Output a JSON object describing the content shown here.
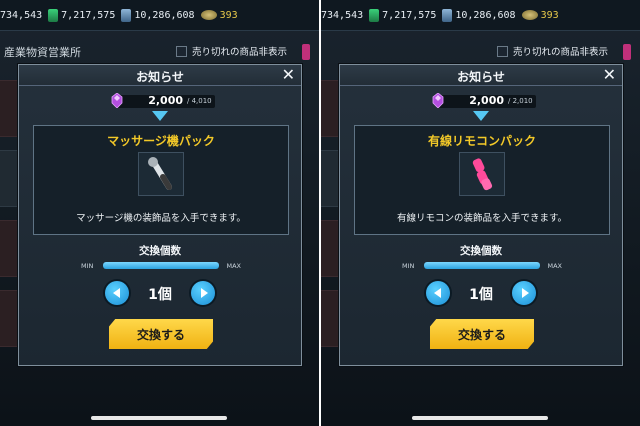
{
  "left": {
    "resources": [
      "734,543",
      "7,217,575",
      "10,286,608",
      "393"
    ],
    "shop_title": "産業物資営業所",
    "hide_soldout": "売り切れの商品非表示",
    "modal": {
      "title": "お知らせ",
      "close": "✕",
      "cost_value": "2,000",
      "cost_max": "/ 4,010",
      "item_name": "マッサージ機パック",
      "item_desc": "マッサージ機の装飾品を入手できます。",
      "qty_label": "交換個数",
      "slider_min": "MIN",
      "slider_max": "MAX",
      "slider_fraction": 1.0,
      "qty_value": "1個",
      "exchange": "交換する"
    }
  },
  "right": {
    "resources": [
      "734,543",
      "7,217,575",
      "10,286,608",
      "393"
    ],
    "shop_title": "",
    "hide_soldout": "売り切れの商品非表示",
    "modal": {
      "title": "お知らせ",
      "close": "✕",
      "cost_value": "2,000",
      "cost_max": "/ 2,010",
      "item_name": "有線リモコンパック",
      "item_desc": "有線リモコンの装飾品を入手できます。",
      "qty_label": "交換個数",
      "slider_min": "MIN",
      "slider_max": "MAX",
      "slider_fraction": 1.0,
      "qty_value": "1個",
      "exchange": "交換する"
    }
  },
  "icons": {
    "resource_1": "green-fuel-icon",
    "resource_2": "steel-icon",
    "resource_3": "gold-icon",
    "cost": "purple-gem-icon"
  },
  "colors": {
    "accent_blue": "#56c7f2",
    "button_yellow": "#f6c526",
    "title_yellow": "#f3c928",
    "gold_text": "#e6c84a"
  }
}
